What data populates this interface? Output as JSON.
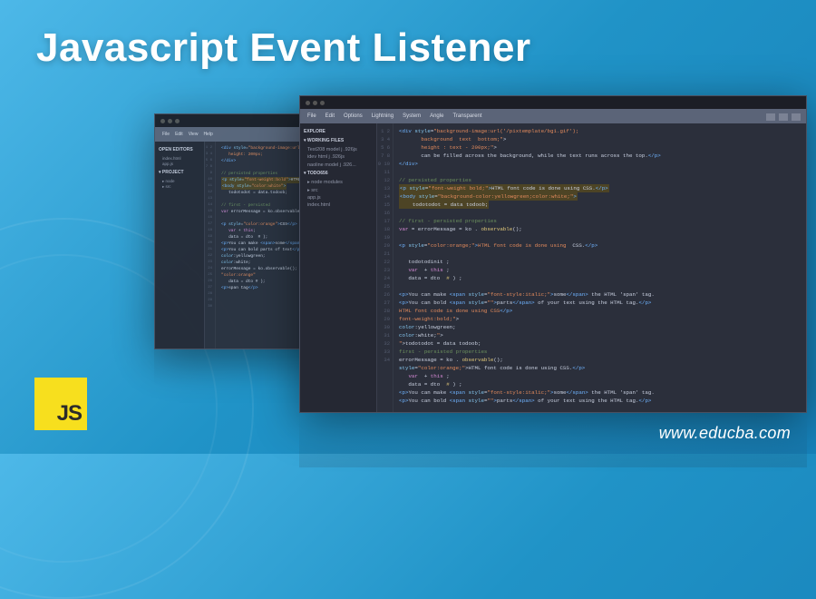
{
  "title": "Javascript Event Listener",
  "website": "www.educba.com",
  "js_badge": "JS",
  "menu": [
    "File",
    "Edit",
    "Options",
    "Lightning",
    "System",
    "Angle",
    "Transparent"
  ],
  "menu_back": [
    "File",
    "Edit",
    "View",
    "Help"
  ],
  "sidebar_front": {
    "explore": "EXPLORE",
    "working": "WORKING FILES",
    "files": [
      "Test208 model j .926js",
      "idev html j .926js",
      "naoline model j .926..."
    ],
    "project": "TODO656",
    "tree": [
      "▸ node modules",
      "▸ src",
      "  app.js",
      "  index.html"
    ]
  },
  "sidebar_back": {
    "open": "OPEN EDITORS",
    "files": [
      "index.html",
      "app.js"
    ],
    "folder": "PROJECT",
    "tree": [
      "▸ node",
      "▸ src"
    ]
  },
  "code_lines": [
    "<div style=\"background-image:url('/pixtemplate/bg1.gif');",
    "       background  text  bottom;\">",
    "       height : text - 200px;\">",
    "       can be filled across the background, while the text runs across the top.</p>",
    "</div>",
    "",
    "// persisted properties",
    "<p style=\"font-weight bold;\">HTML font code is done using CSS.</p>",
    "<body style=\"background-color:yellowgreen;color:white;\">",
    "    todotodot = data todoob;",
    "",
    "// first - persisted properties",
    "var = errorMessage = ko . observable();",
    "",
    "<p style=\"color:orange;\">HTML font code is done using  CSS.</p>",
    "",
    "   todotodinit ;",
    "   var  + this ;",
    "   data = dto  # ) ;",
    "",
    "<p>You can make <span style=\"font-style:italic;\">some</span> the HTML 'span' tag.",
    "<p>You can bold <span style=\"\">parts</span> of your text using the HTML tag.</p>",
    "HTML font code is done using CSS</p>",
    "font-weight:bold;\">",
    "color:yellowgreen;",
    "color:white;\">",
    "\">todotodot = data todoob;",
    "first - persisted properties",
    "errorMessage = ko . observable();",
    "style=\"color:orange;\">HTML font code is done using CSS.</p>",
    "   var  + this ;",
    "   data = dto  # ) ;",
    "<p>You can make <span style=\"font-style:italic;\">some</span> the HTML 'span' tag.",
    "<p>You can bold <span style=\"\">parts</span> of your text using the HTML tag.</p>"
  ]
}
